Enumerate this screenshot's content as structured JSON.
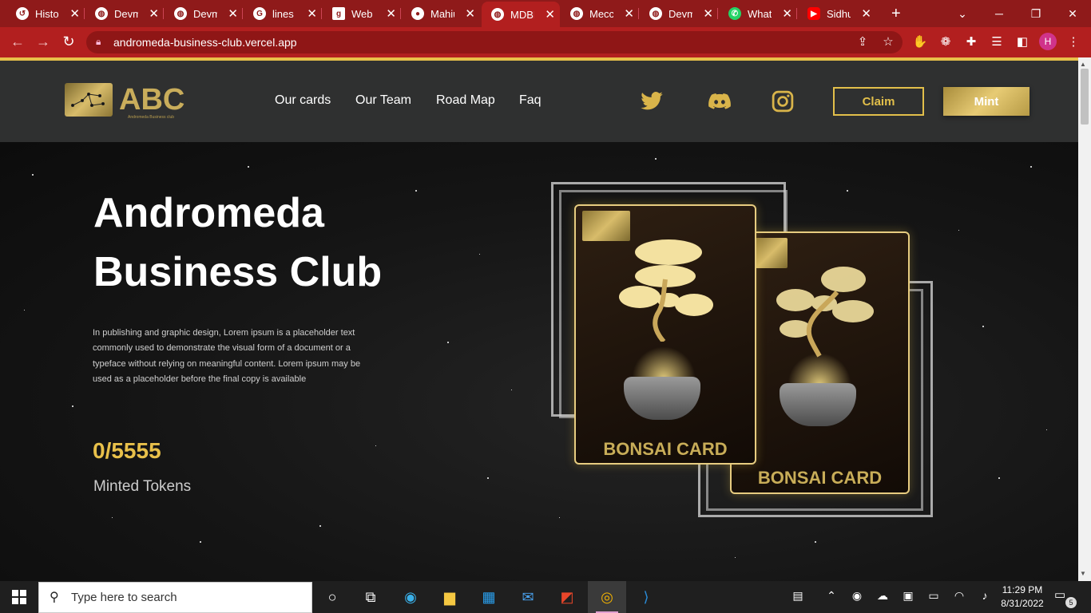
{
  "browser": {
    "tabs": [
      {
        "title": "History",
        "icon": "history-icon"
      },
      {
        "title": "Devmart",
        "icon": "globe-icon"
      },
      {
        "title": "Devmart",
        "icon": "globe-icon"
      },
      {
        "title": "lines at",
        "icon": "google-icon"
      },
      {
        "title": "Web D",
        "icon": "g-icon"
      },
      {
        "title": "Mahiul",
        "icon": "avatar-icon"
      },
      {
        "title": "MDBR",
        "icon": "globe-icon",
        "active": true
      },
      {
        "title": "Mecca",
        "icon": "globe-icon"
      },
      {
        "title": "Devma",
        "icon": "globe-icon"
      },
      {
        "title": "Whats",
        "icon": "whatsapp-icon"
      },
      {
        "title": "Sidhu",
        "icon": "youtube-icon"
      }
    ],
    "new_tab": "+",
    "url": "andromeda-business-club.vercel.app",
    "profile_initial": "H",
    "accent_color": "#b21f1f"
  },
  "site": {
    "logo_text": "ABC",
    "logo_subtext": "Andromeda Business club",
    "nav": [
      "Our cards",
      "Our Team",
      "Road Map",
      "Faq"
    ],
    "social": [
      "twitter-icon",
      "discord-icon",
      "instagram-icon"
    ],
    "claim_label": "Claim",
    "mint_label": "Mint",
    "gold_color": "#e2bf4a"
  },
  "hero": {
    "title_line1": "Andromeda",
    "title_line2": "Business Club",
    "description": "In publishing and graphic design, Lorem ipsum is a placeholder text commonly used to demonstrate the visual form of a document or a typeface without relying on meaningful content. Lorem ipsum may be used as a placeholder before the final copy is available",
    "token_count": "0/5555",
    "token_label": "Minted Tokens",
    "cards": [
      {
        "label": "BONSAI CARD"
      },
      {
        "label": "BONSAI CARD"
      }
    ]
  },
  "taskbar": {
    "search_placeholder": "Type here to search",
    "apps": [
      "cortana-icon",
      "task-view-icon",
      "edge-icon",
      "file-explorer-icon",
      "store-icon",
      "mail-icon",
      "office-icon",
      "chrome-icon",
      "vscode-icon"
    ],
    "time": "11:29 PM",
    "date": "8/31/2022",
    "notification_count": "5"
  }
}
